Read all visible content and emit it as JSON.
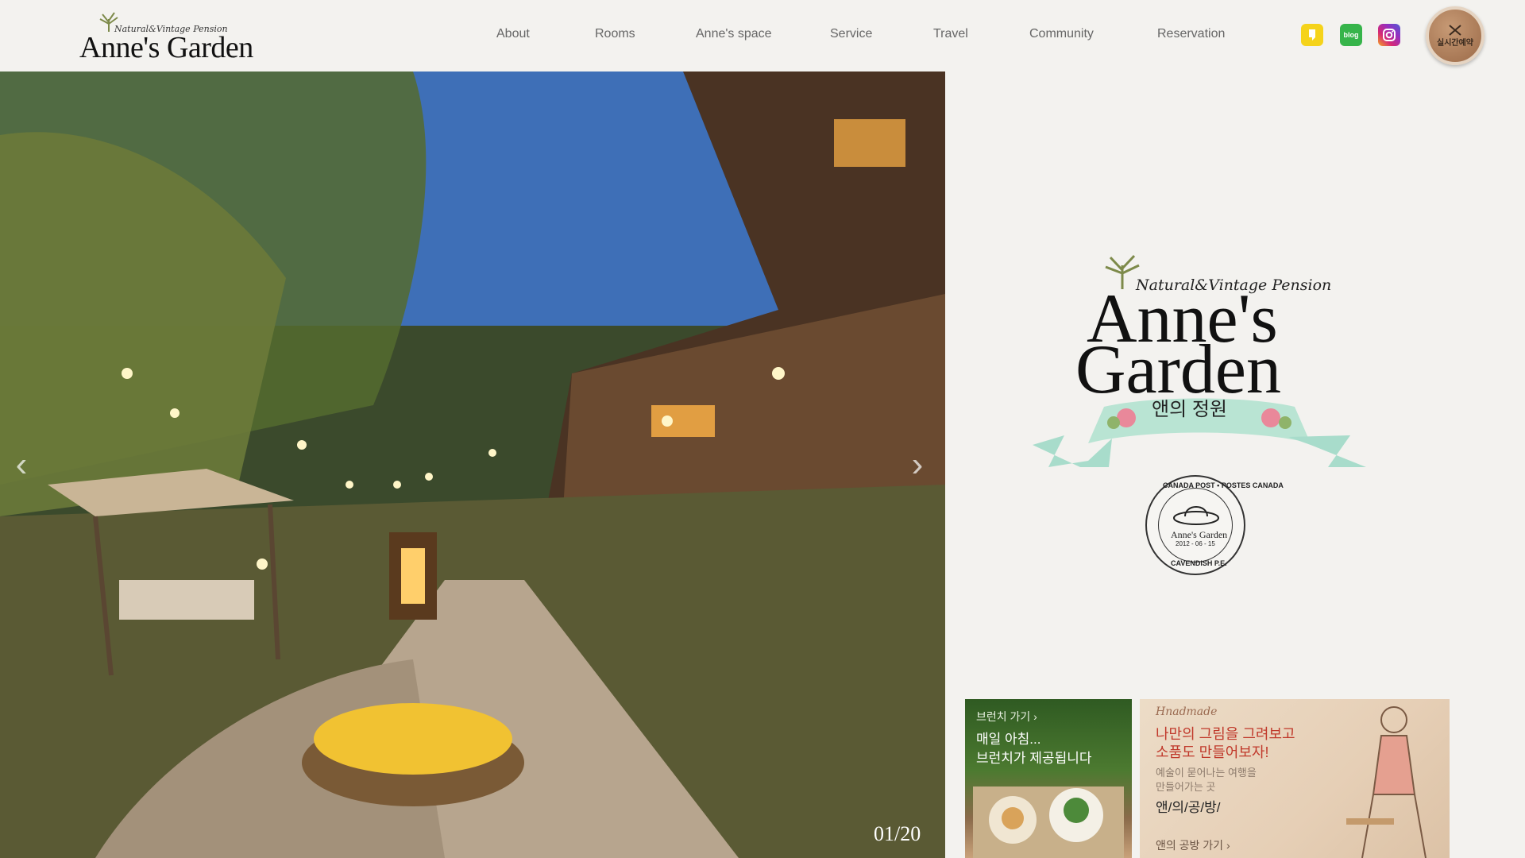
{
  "logo": {
    "tagline": "Natural&Vintage Pension",
    "name": "Anne's Garden"
  },
  "nav": {
    "items": [
      {
        "label": "About"
      },
      {
        "label": "Rooms"
      },
      {
        "label": "Anne's space"
      },
      {
        "label": "Service"
      },
      {
        "label": "Travel"
      },
      {
        "label": "Community"
      },
      {
        "label": "Reservation"
      }
    ]
  },
  "social": {
    "kakao_icon": "kakao-icon",
    "blog_label": "blog",
    "instagram_icon": "instagram-icon"
  },
  "reserve_badge": {
    "label": "실시간예약"
  },
  "hero": {
    "counter": "01/20"
  },
  "brand": {
    "tagline": "Natural&Vintage Pension",
    "line1": "Anne's",
    "line2": "Garden",
    "korean": "앤의 정원"
  },
  "stamp": {
    "top_text": "CANADA POST • POSTES CANADA",
    "name": "Anne's Garden",
    "date": "2012 - 06 - 15",
    "bottom_text": "CAVENDISH P.E."
  },
  "cards": {
    "brunch": {
      "link": "브런치 가기 ›",
      "line1": "매일 아침...",
      "line2": "브런치가 제공됩니다"
    },
    "craft": {
      "handmade": "Hnadmade",
      "headline1": "나만의 그림을 그려보고",
      "headline2": "소품도 만들어보자!",
      "sub1": "예술이 묻어나는 여행을",
      "sub2": "만들어가는 곳",
      "tag": "앤/의/공/방/",
      "link": "앤의 공방 가기 ›"
    }
  },
  "colors": {
    "accent": "#c0392b",
    "background": "#f3f2ef"
  }
}
